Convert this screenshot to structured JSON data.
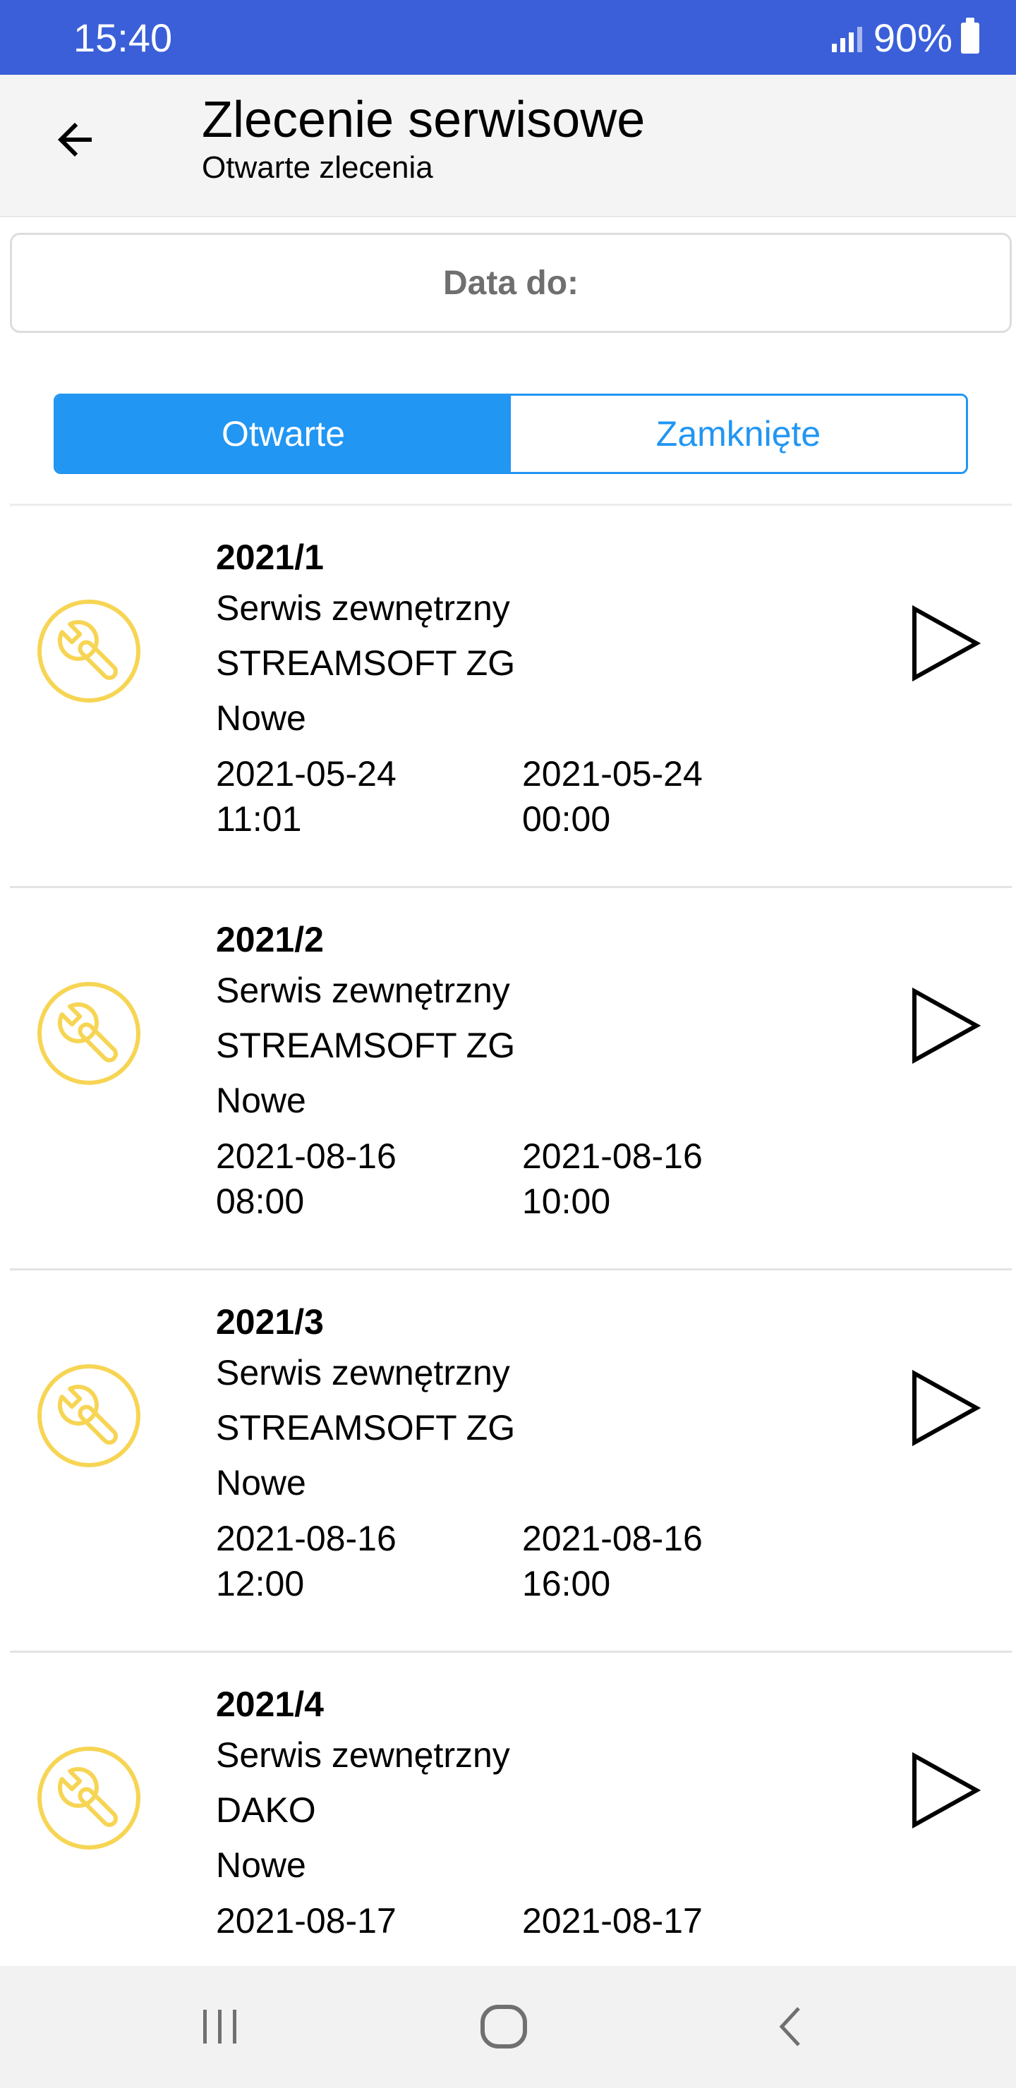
{
  "status_bar": {
    "time": "15:40",
    "battery": "90%",
    "signal_icon": "signal-icon",
    "battery_icon": "battery-icon"
  },
  "app_bar": {
    "back_icon": "arrow-left-icon",
    "title": "Zlecenie serwisowe",
    "subtitle": "Otwarte zlecenia"
  },
  "date_filter": {
    "label": "Data do:"
  },
  "tabs": [
    {
      "label": "Otwarte",
      "active": true
    },
    {
      "label": "Zamknięte",
      "active": false
    }
  ],
  "colors": {
    "status_bar": "#3a5fd8",
    "accent": "#2196f3",
    "icon": "#f7d554"
  },
  "orders": [
    {
      "number": "2021/1",
      "type": "Serwis zewnętrzny",
      "client": "STREAMSOFT ZG",
      "status": "Nowe",
      "start_date": "2021-05-24",
      "start_time": "11:01",
      "end_date": "2021-05-24",
      "end_time": "00:00"
    },
    {
      "number": "2021/2",
      "type": "Serwis zewnętrzny",
      "client": "STREAMSOFT ZG",
      "status": "Nowe",
      "start_date": "2021-08-16",
      "start_time": "08:00",
      "end_date": "2021-08-16",
      "end_time": "10:00"
    },
    {
      "number": "2021/3",
      "type": "Serwis zewnętrzny",
      "client": "STREAMSOFT ZG",
      "status": "Nowe",
      "start_date": "2021-08-16",
      "start_time": "12:00",
      "end_date": "2021-08-16",
      "end_time": "16:00"
    },
    {
      "number": "2021/4",
      "type": "Serwis zewnętrzny",
      "client": "DAKO",
      "status": "Nowe",
      "start_date": "2021-08-17",
      "start_time": "",
      "end_date": "2021-08-17",
      "end_time": ""
    }
  ],
  "order_icons": {
    "left": "wrench-icon",
    "right": "play-icon"
  },
  "nav_bar": {
    "recents_icon": "recents-icon",
    "home_icon": "home-icon",
    "back_icon": "back-icon"
  }
}
